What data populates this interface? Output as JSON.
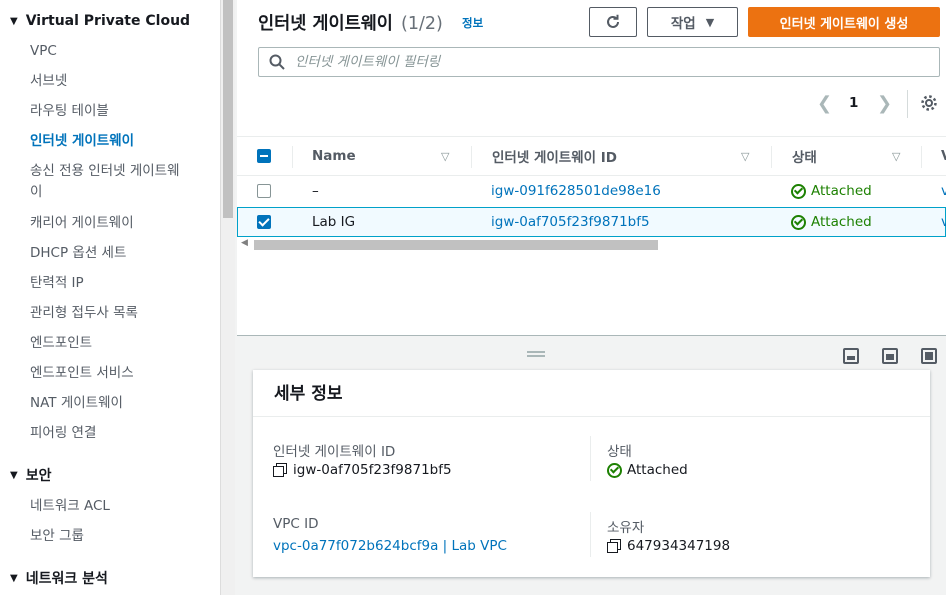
{
  "sidebar": {
    "sections": [
      {
        "label": "Virtual Private Cloud"
      },
      {
        "label": "보안"
      },
      {
        "label": "네트워크 분석"
      }
    ],
    "items": [
      {
        "label": "VPC"
      },
      {
        "label": "서브넷"
      },
      {
        "label": "라우팅 테이블"
      },
      {
        "label": "인터넷 게이트웨이"
      },
      {
        "label": "송신 전용 인터넷 게이트웨이"
      },
      {
        "label": "캐리어 게이트웨이"
      },
      {
        "label": "DHCP 옵션 세트"
      },
      {
        "label": "탄력적 IP"
      },
      {
        "label": "관리형 접두사 목록"
      },
      {
        "label": "엔드포인트"
      },
      {
        "label": "엔드포인트 서비스"
      },
      {
        "label": "NAT 게이트웨이"
      },
      {
        "label": "피어링 연결"
      },
      {
        "label": "네트워크 ACL"
      },
      {
        "label": "보안 그룹"
      }
    ]
  },
  "header": {
    "title": "인터넷 게이트웨이",
    "count": "(1/2)",
    "info": "정보",
    "actions_label": "작업",
    "create_label": "인터넷 게이트웨이 생성"
  },
  "filter": {
    "placeholder": "인터넷 게이트웨이 필터링"
  },
  "pagination": {
    "page": "1"
  },
  "table": {
    "columns": [
      "Name",
      "인터넷 게이트웨이 ID",
      "상태",
      "V"
    ],
    "rows": [
      {
        "name": "–",
        "id": "igw-091f628501de98e16",
        "status": "Attached",
        "extra": "v",
        "selected": false
      },
      {
        "name": "Lab IG",
        "id": "igw-0af705f23f9871bf5",
        "status": "Attached",
        "extra": "v",
        "selected": true
      }
    ]
  },
  "details": {
    "title": "세부 정보",
    "igw_id_label": "인터넷 게이트웨이 ID",
    "igw_id": "igw-0af705f23f9871bf5",
    "state_label": "상태",
    "state": "Attached",
    "vpc_id_label": "VPC ID",
    "vpc_id": "vpc-0a77f072b624bcf9a | Lab VPC",
    "owner_label": "소유자",
    "owner": "647934347198"
  },
  "colors": {
    "primary": "#ec7211",
    "link": "#0073bb",
    "success": "#1d8102"
  }
}
